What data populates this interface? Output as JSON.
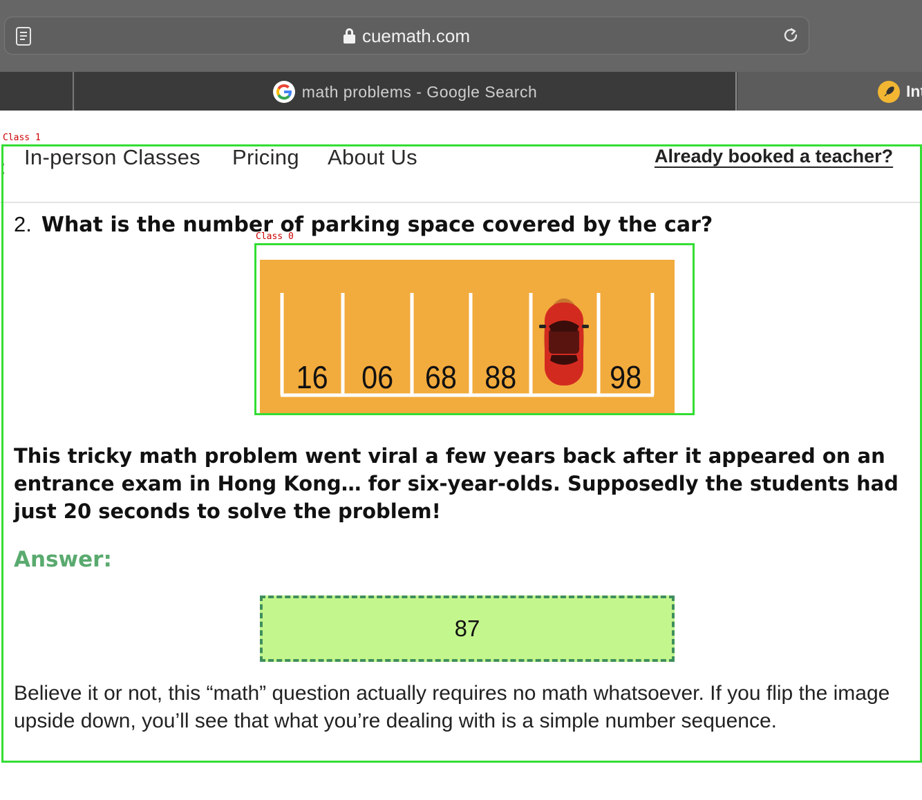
{
  "browser": {
    "url": "cuemath.com",
    "tabs": [
      {
        "title": "",
        "active": false
      },
      {
        "title": "math problems - Google Search",
        "icon": "google-icon",
        "active": true
      },
      {
        "title": "Int",
        "icon": "rocket-icon",
        "active": false
      }
    ]
  },
  "annotations": {
    "page_region_label": "Class 1",
    "image_region_label": "Class 0",
    "box_color": "#33dd33",
    "label_color": "#cc0000"
  },
  "nav": {
    "items": [
      "In-person Classes",
      "Pricing",
      "About Us"
    ],
    "cta": "Already booked a teacher?"
  },
  "question": {
    "number": "2.",
    "text": "What is the number of parking space covered by the car?"
  },
  "parking_image": {
    "spot_numbers": [
      "16",
      "06",
      "68",
      "88",
      "98"
    ],
    "car_color": "#d32a20",
    "background": "#f2ab3d"
  },
  "intro": "This tricky math problem went viral a few years back after it appeared on an entrance exam in Hong Kong… for six-year-olds. Supposedly the students had just 20 seconds to solve the problem!",
  "answer": {
    "label": "Answer:",
    "value": "87"
  },
  "explanation": "Believe it or not, this “math” question actually requires no math whatsoever. If you flip the image upside down, you’ll see that what you’re dealing with is a simple number sequence."
}
